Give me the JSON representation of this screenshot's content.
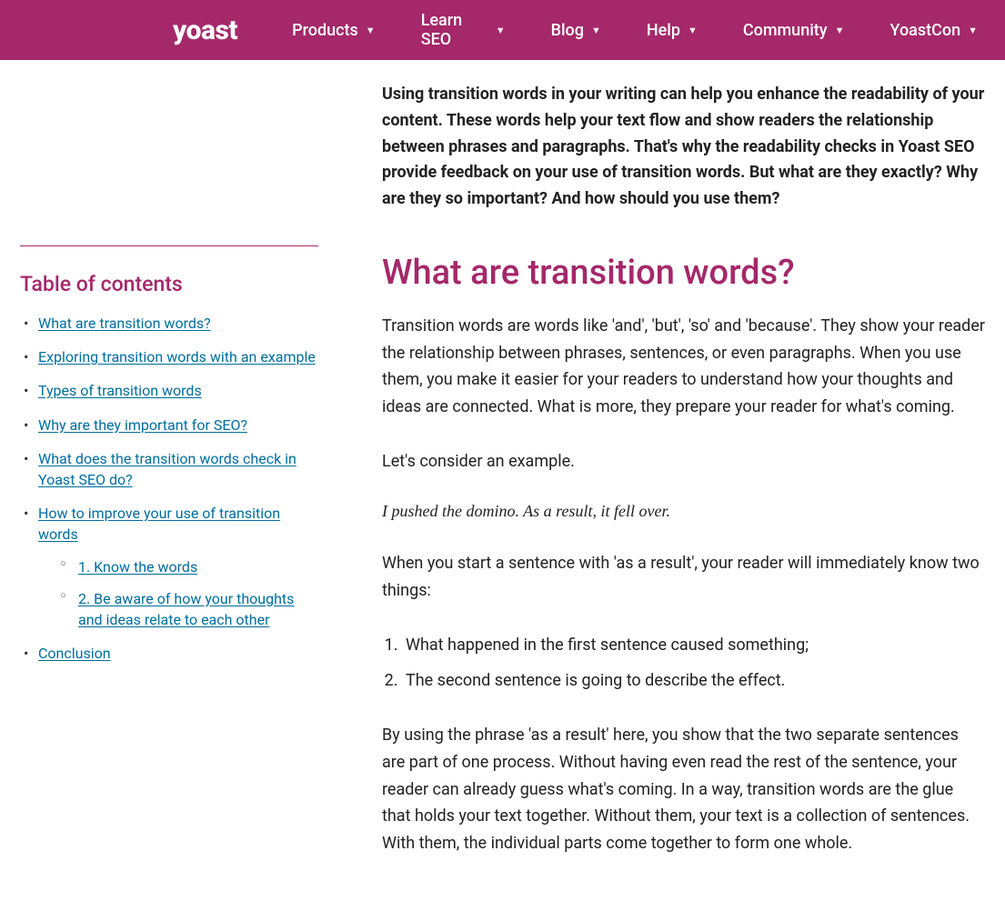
{
  "brand": "yoast",
  "nav": {
    "items": [
      {
        "label": "Products"
      },
      {
        "label": "Learn SEO"
      },
      {
        "label": "Blog"
      },
      {
        "label": "Help"
      },
      {
        "label": "Community"
      },
      {
        "label": "YoastCon"
      }
    ]
  },
  "toc": {
    "title": "Table of contents",
    "items": [
      {
        "label": "What are transition words?"
      },
      {
        "label": "Exploring transition words with an example"
      },
      {
        "label": "Types of transition words"
      },
      {
        "label": "Why are they important for SEO?"
      },
      {
        "label": "What does the transition words check in Yoast SEO do?"
      },
      {
        "label": "How to improve your use of transition words",
        "sub": [
          {
            "label": "1. Know the words"
          },
          {
            "label": "2. Be aware of how your thoughts and ideas relate to each other"
          }
        ]
      },
      {
        "label": "Conclusion"
      }
    ]
  },
  "article": {
    "intro": "Using transition words in your writing can help you enhance the readability of your content. These words help your text flow and show readers the relationship between phrases and paragraphs. That's why the readability checks in Yoast SEO provide feedback on your use of transition words. But what are they exactly? Why are they so important? And how should you use them?",
    "h2": "What are transition words?",
    "p1": "Transition words are words like 'and', 'but', 'so' and 'because'. They show your reader the relationship between phrases, sentences, or even paragraphs. When you use them, you make it easier for your readers to understand how your thoughts and ideas are connected. What is more, they prepare your reader for what's coming.",
    "p2": "Let's consider an example.",
    "example": "I pushed the domino. As a result, it fell over.",
    "p3": "When you start a sentence with 'as a result', your reader will immediately know two things:",
    "list": [
      "What happened in the first sentence caused something;",
      "The second sentence is going to describe the effect."
    ],
    "p4": "By using the phrase 'as a result' here, you show that the two separate sentences are part of one process. Without having even read the rest of the sentence, your reader can already guess what's coming. In a way, transition words are the glue that holds your text together. Without them, your text is a collection of sentences. With them, the individual parts come together to form one whole."
  }
}
